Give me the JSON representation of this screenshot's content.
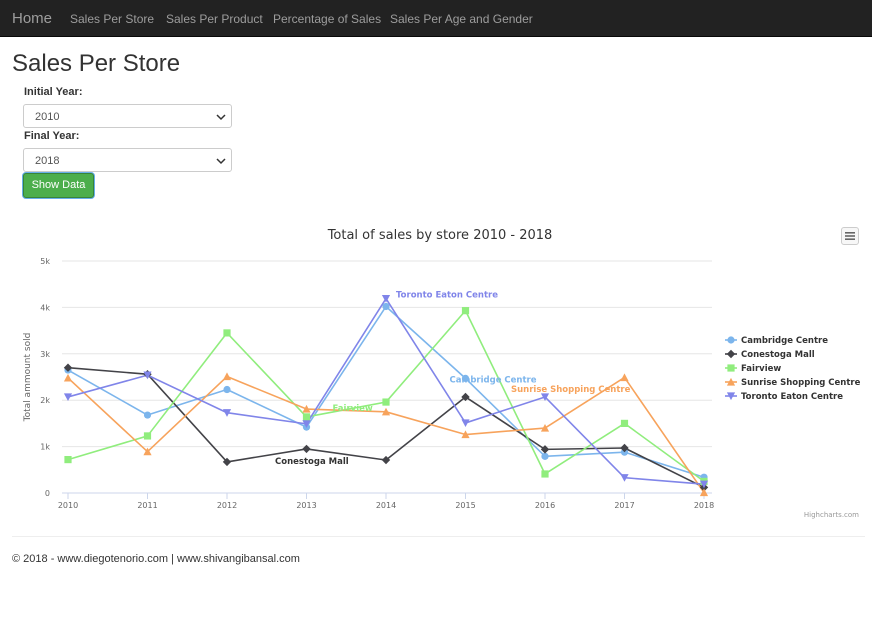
{
  "nav": {
    "home": "Home",
    "items": [
      "Sales Per Store",
      "Sales Per Product",
      "Percentage of Sales",
      "Sales Per Age and Gender"
    ]
  },
  "page": {
    "title": "Sales Per Store"
  },
  "form": {
    "initial_label": "Initial Year:",
    "initial_value": "2010",
    "final_label": "Final Year:",
    "final_value": "2018",
    "button_label": "Show Data"
  },
  "footer": {
    "text": "© 2018 - www.diegotenorio.com | www.shivangibansal.com"
  },
  "chart_data": {
    "type": "line",
    "title": "Total of sales by store 2010 - 2018",
    "ylabel": "Total ammount sold",
    "xlabel": "",
    "x": [
      2010,
      2011,
      2012,
      2013,
      2014,
      2015,
      2016,
      2017,
      2018
    ],
    "ylim": [
      0,
      5000
    ],
    "yticks": [
      0,
      1000,
      2000,
      3000,
      4000,
      5000
    ],
    "ytick_labels": [
      "0",
      "1k",
      "2k",
      "3k",
      "4k",
      "5k"
    ],
    "grid": true,
    "legend_position": "right",
    "credits": "Highcharts.com",
    "series": [
      {
        "name": "Cambridge Centre",
        "color": "#7cb5ec",
        "marker": "circle",
        "values": [
          2650,
          1680,
          2230,
          1420,
          4020,
          2470,
          790,
          880,
          340
        ],
        "label": "Cambridge Centre",
        "label_at": 2015
      },
      {
        "name": "Conestoga Mall",
        "color": "#434348",
        "marker": "diamond",
        "values": [
          2700,
          2560,
          670,
          950,
          710,
          2070,
          940,
          970,
          120
        ],
        "label": "Conestoga Mall",
        "label_at": 2012
      },
      {
        "name": "Fairview",
        "color": "#90ed7d",
        "marker": "square",
        "values": [
          720,
          1230,
          3450,
          1640,
          1960,
          3930,
          410,
          1500,
          250
        ],
        "label": "Fairview",
        "label_at": 2013
      },
      {
        "name": "Sunrise Shopping Centre",
        "color": "#f7a35c",
        "marker": "triangle",
        "values": [
          2480,
          890,
          2510,
          1810,
          1750,
          1260,
          1400,
          2490,
          10
        ],
        "label": "Sunrise Shopping Centre",
        "label_at": 2016
      },
      {
        "name": "Toronto Eaton Centre",
        "color": "#8085e9",
        "marker": "triangle-down",
        "values": [
          2070,
          2540,
          1730,
          1490,
          4190,
          1510,
          2070,
          330,
          190
        ],
        "label": "Toronto Eaton Centre",
        "label_at": 2014
      }
    ]
  }
}
